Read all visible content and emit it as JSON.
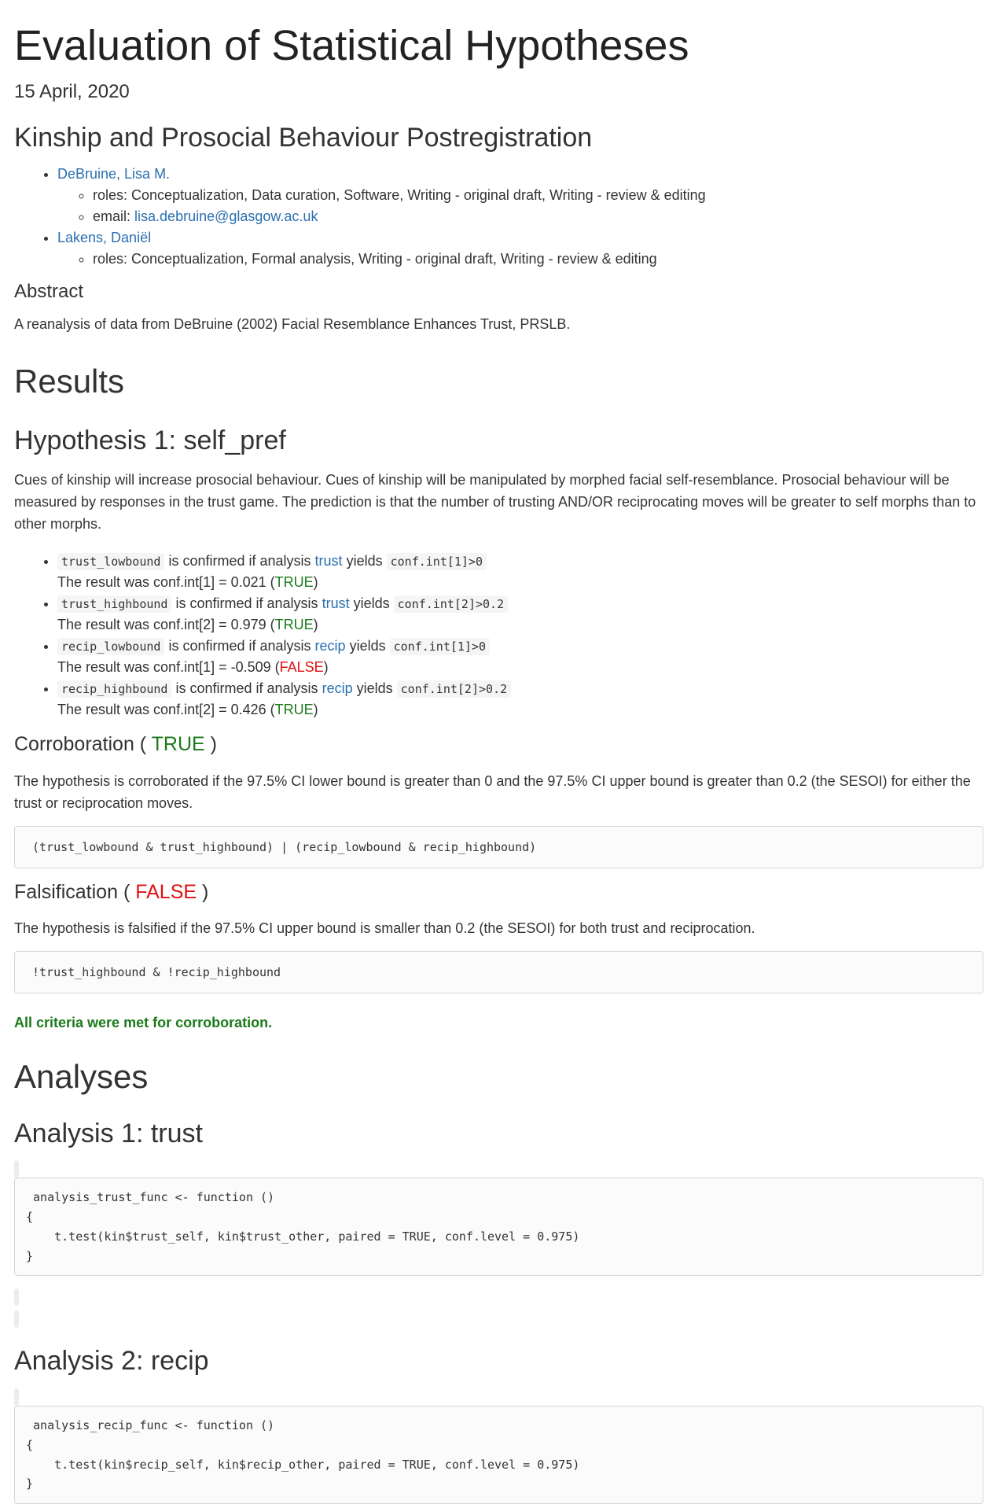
{
  "title": "Evaluation of Statistical Hypotheses",
  "date": "15 April, 2020",
  "study_title": "Kinship and Prosocial Behaviour Postregistration",
  "authors": [
    {
      "name": "DeBruine, Lisa M.",
      "roles_label": "roles:",
      "roles": "Conceptualization, Data curation, Software, Writing - original draft, Writing - review & editing",
      "email_label": "email:",
      "email": "lisa.debruine@glasgow.ac.uk"
    },
    {
      "name": "Lakens, Daniël",
      "roles_label": "roles:",
      "roles": "Conceptualization, Formal analysis, Writing - original draft, Writing - review & editing"
    }
  ],
  "abstract": {
    "heading": "Abstract",
    "text": "A reanalysis of data from DeBruine (2002) Facial Resemblance Enhances Trust, PRSLB."
  },
  "results": {
    "heading": "Results",
    "hypothesis_heading": "Hypothesis 1: self_pref",
    "hypothesis_desc": "Cues of kinship will increase prosocial behaviour. Cues of kinship will be manipulated by morphed facial self-resemblance. Prosocial behaviour will be measured by responses in the trust game. The prediction is that the number of trusting AND/OR reciprocating moves will be greater to self morphs than to other morphs.",
    "criteria": [
      {
        "name": "trust_lowbound",
        "pre": "is confirmed if analysis",
        "analysis": "trust",
        "mid": "yields",
        "condition": "conf.int[1]>0",
        "result_text": "The result was conf.int[1] = 0.021 (",
        "result_value": "TRUE",
        "result_close": ")",
        "ok": true
      },
      {
        "name": "trust_highbound",
        "pre": "is confirmed if analysis",
        "analysis": "trust",
        "mid": "yields",
        "condition": "conf.int[2]>0.2",
        "result_text": "The result was conf.int[2] = 0.979 (",
        "result_value": "TRUE",
        "result_close": ")",
        "ok": true
      },
      {
        "name": "recip_lowbound",
        "pre": "is confirmed if analysis",
        "analysis": "recip",
        "mid": "yields",
        "condition": "conf.int[1]>0",
        "result_text": "The result was conf.int[1] = -0.509 (",
        "result_value": "FALSE",
        "result_close": ")",
        "ok": false
      },
      {
        "name": "recip_highbound",
        "pre": "is confirmed if analysis",
        "analysis": "recip",
        "mid": "yields",
        "condition": "conf.int[2]>0.2",
        "result_text": "The result was conf.int[2] = 0.426 (",
        "result_value": "TRUE",
        "result_close": ")",
        "ok": true
      }
    ],
    "corroboration": {
      "label": "Corroboration (",
      "value": "TRUE",
      "close": ")",
      "text": "The hypothesis is corroborated if the 97.5% CI lower bound is greater than 0 and the 97.5% CI upper bound is greater than 0.2 (the SESOI) for either the trust or reciprocation moves.",
      "code": "(trust_lowbound & trust_highbound) | (recip_lowbound & recip_highbound)"
    },
    "falsification": {
      "label": "Falsification (",
      "value": "FALSE",
      "close": ")",
      "text": "The hypothesis is falsified if the 97.5% CI upper bound is smaller than 0.2 (the SESOI) for both trust and reciprocation.",
      "code": "!trust_highbound & !recip_highbound"
    },
    "conclusion": "All criteria were met for corroboration."
  },
  "analyses": {
    "heading": "Analyses",
    "items": [
      {
        "heading": "Analysis 1: trust",
        "code": " analysis_trust_func <- function ()\n{\n    t.test(kin$trust_self, kin$trust_other, paired = TRUE, conf.level = 0.975)\n}"
      },
      {
        "heading": "Analysis 2: recip",
        "code": " analysis_recip_func <- function ()\n{\n    t.test(kin$recip_self, kin$recip_other, paired = TRUE, conf.level = 0.975)\n}"
      }
    ]
  },
  "colors": {
    "link": "#2a6fb0",
    "true": "#1a7a1a",
    "false": "#e01010"
  }
}
